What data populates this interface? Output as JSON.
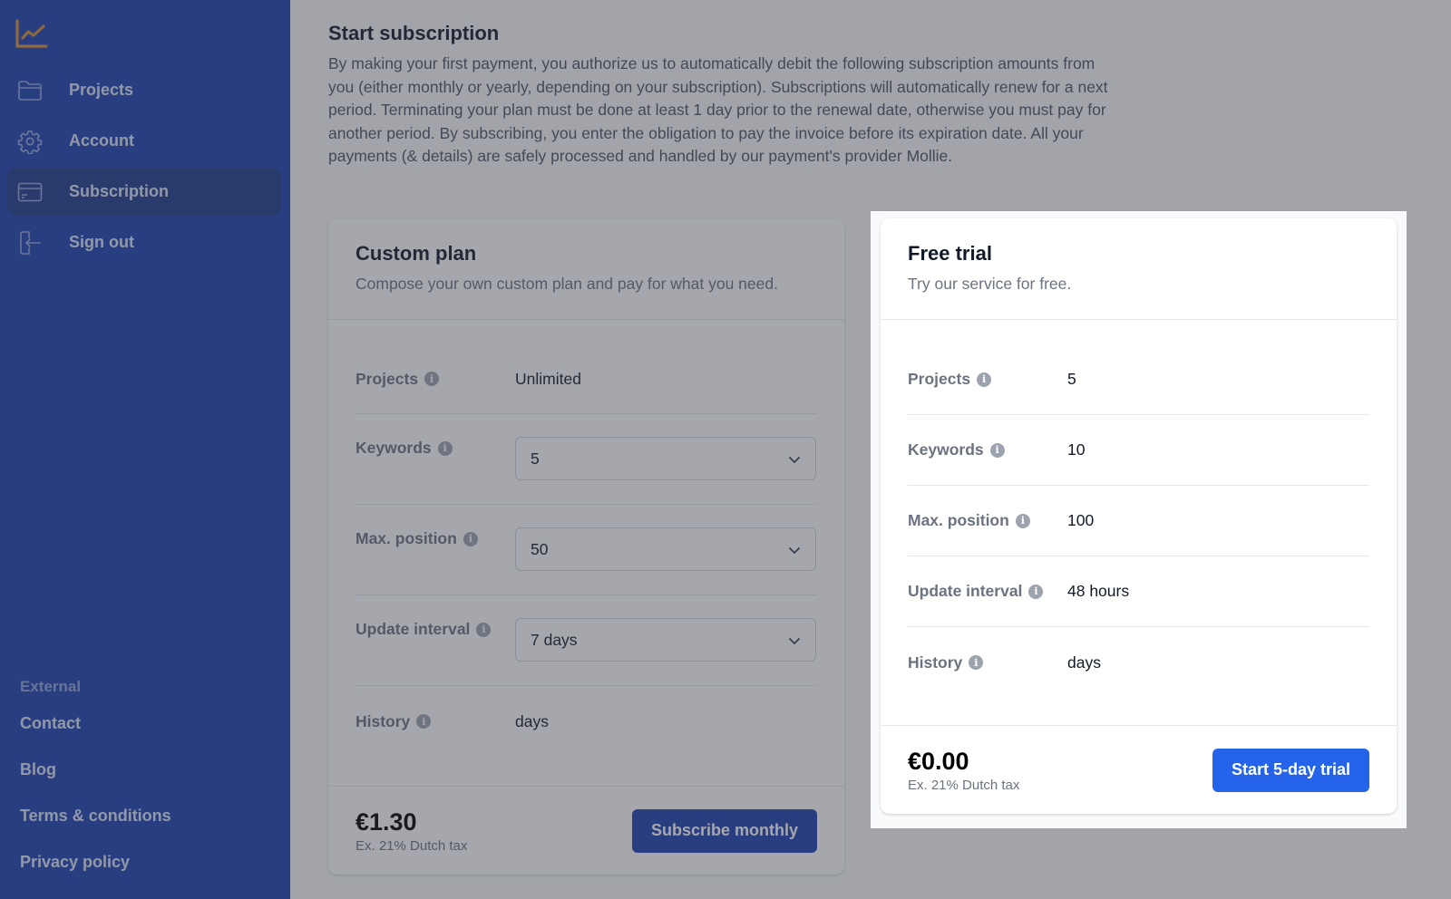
{
  "sidebar": {
    "logo": "chart-line-icon",
    "nav": [
      {
        "label": "Projects",
        "icon": "folder-icon",
        "active": false
      },
      {
        "label": "Account",
        "icon": "gear-icon",
        "active": false
      },
      {
        "label": "Subscription",
        "icon": "credit-card-icon",
        "active": true
      },
      {
        "label": "Sign out",
        "icon": "sign-out-icon",
        "active": false
      }
    ],
    "external_label": "External",
    "external_links": [
      "Contact",
      "Blog",
      "Terms & conditions",
      "Privacy policy"
    ]
  },
  "main": {
    "title": "Start subscription",
    "intro": "By making your first payment, you authorize us to automatically debit the following subscription amounts from you (either monthly or yearly, depending on your subscription). Subscriptions will automatically renew for a next period. Terminating your plan must be done at least 1 day prior to the renewal date, otherwise you must pay for another period. By subscribing, you enter the obligation to pay the invoice before its expiration date. All your payments (& details) are safely processed and handled by our payment's provider Mollie.",
    "custom_plan": {
      "title": "Custom plan",
      "subtitle": "Compose your own custom plan and pay for what you need.",
      "projects_label": "Projects",
      "projects_value": "Unlimited",
      "keywords_label": "Keywords",
      "keywords_value": "5",
      "max_position_label": "Max. position",
      "max_position_value": "50",
      "update_interval_label": "Update interval",
      "update_interval_value": "7 days",
      "history_label": "History",
      "history_value": "days",
      "price": "€1.30",
      "tax_note": "Ex. 21% Dutch tax",
      "button": "Subscribe monthly"
    },
    "free_trial": {
      "title": "Free trial",
      "subtitle": "Try our service for free.",
      "rows": [
        {
          "label": "Projects",
          "value": "5"
        },
        {
          "label": "Keywords",
          "value": "10"
        },
        {
          "label": "Max. position",
          "value": "100"
        },
        {
          "label": "Update interval",
          "value": "48 hours"
        },
        {
          "label": "History",
          "value": "days"
        }
      ],
      "price": "€0.00",
      "tax_note": "Ex. 21% Dutch tax",
      "button": "Start 5-day trial"
    }
  },
  "colors": {
    "sidebar_bg": "#1e40af",
    "sidebar_active": "#1e3a8a",
    "logo": "#d4913a",
    "primary_button": "#2563eb"
  },
  "info_glyph": "i"
}
